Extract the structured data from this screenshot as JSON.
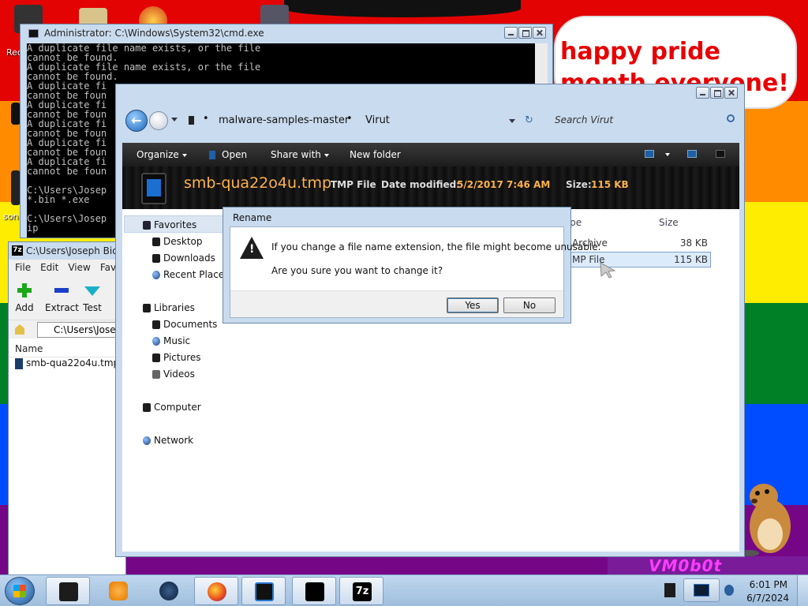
{
  "desktop": {
    "bubble_text": "happy pride month everyone!",
    "left_labels": [
      "Rec",
      "son"
    ],
    "watermark": "VM0b0t"
  },
  "cmd": {
    "title": "Administrator: C:\\Windows\\System32\\cmd.exe",
    "lines": [
      "A duplicate file name exists, or the file",
      "cannot be found.",
      "A duplicate file name exists, or the file",
      "cannot be found.",
      "A duplicate fi",
      "cannot be foun",
      "A duplicate fi",
      "cannot be foun",
      "A duplicate fi",
      "cannot be foun",
      "A duplicate fi",
      "cannot be foun",
      "A duplicate fi",
      "cannot be foun",
      "",
      "C:\\Users\\Josep",
      "*.bin *.exe",
      "",
      "C:\\Users\\Josep",
      "ip"
    ]
  },
  "zip": {
    "title": "C:\\Users\\Joseph Bide",
    "menu": [
      "File",
      "Edit",
      "View",
      "Favo"
    ],
    "toolbar": {
      "add": "Add",
      "extract": "Extract",
      "test": "Test"
    },
    "address": "C:\\Users\\Josep",
    "column_name": "Name",
    "file": "smb-qua22o4u.tmp"
  },
  "explorer": {
    "breadcrumb": [
      "malware-samples-master",
      "Virut"
    ],
    "breadcrumb_sep": "•",
    "search_placeholder": "Search Virut",
    "commands": {
      "organize": "Organize",
      "open": "Open",
      "share": "Share with",
      "new_folder": "New folder"
    },
    "details": {
      "name": "smb-qua22o4u.tmp",
      "type": "TMP File",
      "date_label": "Date modified:",
      "date_value": "5/2/2017 7:46 AM",
      "size_label": "Size:",
      "size_value": "115 KB"
    },
    "nav": {
      "favorites": "Favorites",
      "desktop": "Desktop",
      "downloads": "Downloads",
      "recent": "Recent Places",
      "libraries": "Libraries",
      "documents": "Documents",
      "music": "Music",
      "pictures": "Pictures",
      "videos": "Videos",
      "computer": "Computer",
      "network": "Network"
    },
    "columns": {
      "type": "ype",
      "size": "Size"
    },
    "rows": [
      {
        "type": "Archive",
        "size": "38 KB"
      },
      {
        "type": "MP File",
        "size": "115 KB"
      }
    ]
  },
  "dialog": {
    "title": "Rename",
    "message1": "If you change a file name extension, the file might become unusable.",
    "message2": "Are you sure you want to change it?",
    "yes": "Yes",
    "no": "No"
  },
  "taskbar": {
    "time": "6:01 PM",
    "date": "6/7/2024"
  }
}
